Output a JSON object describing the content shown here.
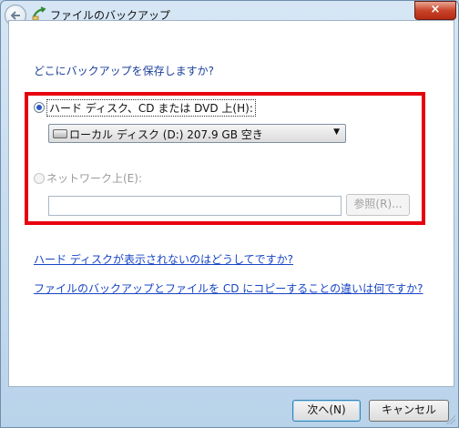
{
  "window": {
    "title": "ファイルのバックアップ",
    "close_glyph": "×"
  },
  "question": "どこにバックアップを保存しますか?",
  "options": {
    "hard_disk": {
      "label": "ハード ディスク、CD または DVD 上(H):",
      "selected": true,
      "drive_value": "ローカル ディスク (D:)  207.9 GB 空き"
    },
    "network": {
      "label": "ネットワーク上(E):",
      "selected": false,
      "path_value": "",
      "browse_label": "参照(R)..."
    }
  },
  "links": {
    "hard_disk_help": "ハード ディスクが表示されないのはどうしてですか?",
    "backup_vs_copy": "ファイルのバックアップとファイルを CD にコピーすることの違いは何ですか?"
  },
  "footer": {
    "next_label": "次へ(N)",
    "cancel_label": "キャンセル"
  },
  "icons": {
    "back": "back-arrow-icon",
    "app": "backup-icon",
    "drive": "drive-icon",
    "dropdown": "chevron-down-icon"
  },
  "colors": {
    "highlight_border": "#e8000d",
    "link": "#1745c4",
    "question_text": "#1c3f9a"
  }
}
